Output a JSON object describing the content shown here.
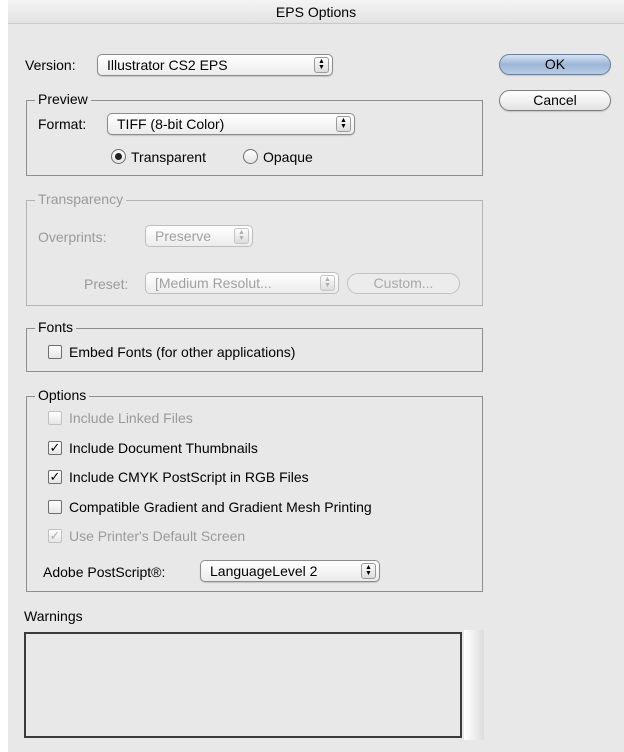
{
  "window": {
    "title": "EPS Options"
  },
  "version": {
    "label": "Version:",
    "value": "Illustrator CS2 EPS"
  },
  "buttons": {
    "ok": "OK",
    "cancel": "Cancel"
  },
  "preview": {
    "title": "Preview",
    "format_label": "Format:",
    "format_value": "TIFF (8-bit Color)",
    "transparent_label": "Transparent",
    "opaque_label": "Opaque",
    "selected": "Transparent"
  },
  "transparency": {
    "title": "Transparency",
    "overprints_label": "Overprints:",
    "overprints_value": "Preserve",
    "preset_label": "Preset:",
    "preset_value": "[Medium Resolut...",
    "custom_label": "Custom..."
  },
  "fonts": {
    "title": "Fonts",
    "embed_label": "Embed Fonts (for other applications)",
    "embed_checked": false
  },
  "options": {
    "title": "Options",
    "items": [
      {
        "label": "Include Linked Files",
        "checked": false,
        "enabled": false
      },
      {
        "label": "Include Document Thumbnails",
        "checked": true,
        "enabled": true
      },
      {
        "label": "Include CMYK PostScript in RGB Files",
        "checked": true,
        "enabled": true
      },
      {
        "label": "Compatible Gradient and Gradient Mesh Printing",
        "checked": false,
        "enabled": true
      },
      {
        "label": "Use Printer's Default Screen",
        "checked": true,
        "enabled": false
      }
    ],
    "postscript_label": "Adobe PostScript®:",
    "postscript_value": "LanguageLevel 2"
  },
  "warnings": {
    "title": "Warnings"
  }
}
